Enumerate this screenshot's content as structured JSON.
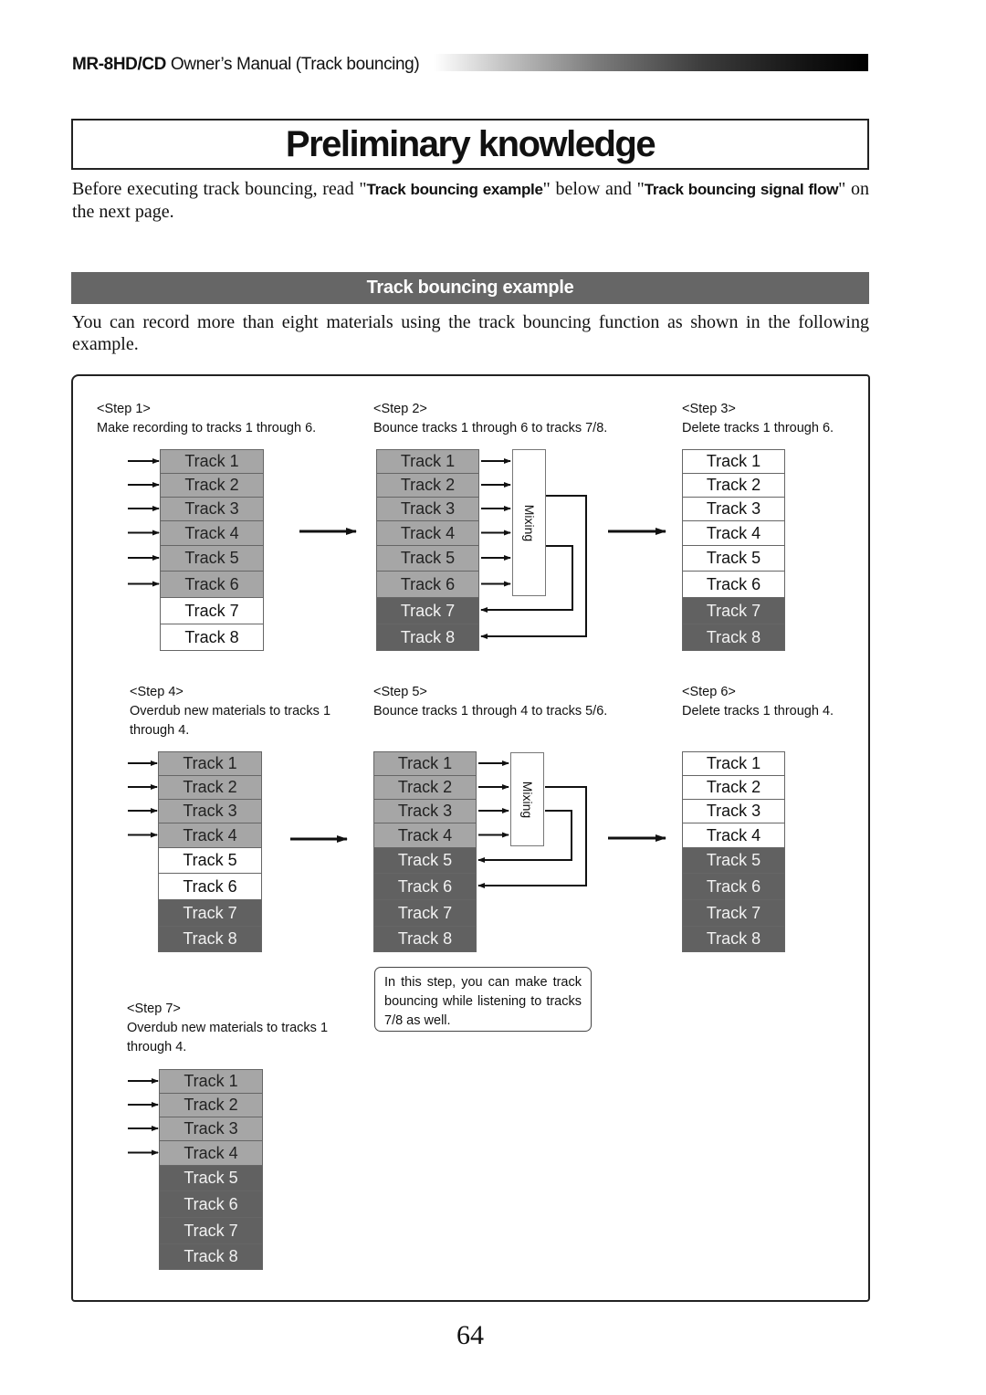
{
  "header": {
    "model": "MR-8HD/CD",
    "title_suffix": " Owner’s Manual (Track bouncing)"
  },
  "page_title": "Preliminary knowledge",
  "intro": {
    "t1": "Before executing track bouncing, read \"",
    "b1": "Track bouncing example",
    "t2": "\" below and \"",
    "b2": "Track bouncing signal flow",
    "t3": "\" on the next page."
  },
  "section": {
    "heading": "Track bouncing example",
    "body": "You can record more than eight materials using the track bouncing function as shown in the following example."
  },
  "steps": [
    {
      "label": "<Step 1>",
      "desc": "Make recording to tracks 1 through 6.",
      "tracks": [
        "Track 1",
        "Track 2",
        "Track 3",
        "Track 4",
        "Track 5",
        "Track 6",
        "Track 7",
        "Track 8"
      ],
      "states": [
        "light",
        "light",
        "light",
        "light",
        "light",
        "light",
        "white",
        "white"
      ],
      "inputs": [
        1,
        2,
        3,
        4,
        5,
        6
      ]
    },
    {
      "label": "<Step 2>",
      "desc": "Bounce tracks 1 through 6 to tracks 7/8.",
      "tracks": [
        "Track 1",
        "Track 2",
        "Track 3",
        "Track 4",
        "Track 5",
        "Track 6",
        "Track 7",
        "Track 8"
      ],
      "states": [
        "light",
        "light",
        "light",
        "light",
        "light",
        "light",
        "dark",
        "dark"
      ],
      "mixing_label": "Mixing",
      "mix_sources": [
        1,
        2,
        3,
        4,
        5,
        6
      ],
      "mix_targets": [
        7,
        8
      ]
    },
    {
      "label": "<Step 3>",
      "desc": "Delete tracks 1 through 6.",
      "tracks": [
        "Track 1",
        "Track 2",
        "Track 3",
        "Track 4",
        "Track 5",
        "Track 6",
        "Track 7",
        "Track 8"
      ],
      "states": [
        "white",
        "white",
        "white",
        "white",
        "white",
        "white",
        "dark",
        "dark"
      ]
    },
    {
      "label": "<Step 4>",
      "desc_line1": "Overdub new materials to tracks 1",
      "desc_line2": "through 4.",
      "tracks": [
        "Track 1",
        "Track 2",
        "Track 3",
        "Track 4",
        "Track 5",
        "Track 6",
        "Track 7",
        "Track 8"
      ],
      "states": [
        "light",
        "light",
        "light",
        "light",
        "white",
        "white",
        "dark",
        "dark"
      ],
      "inputs": [
        1,
        2,
        3,
        4
      ]
    },
    {
      "label": "<Step 5>",
      "desc": "Bounce tracks 1 through 4 to tracks 5/6.",
      "tracks": [
        "Track 1",
        "Track 2",
        "Track 3",
        "Track 4",
        "Track 5",
        "Track 6",
        "Track 7",
        "Track 8"
      ],
      "states": [
        "light",
        "light",
        "light",
        "light",
        "dark",
        "dark",
        "dark",
        "dark"
      ],
      "mixing_label": "Mixing",
      "mix_sources": [
        1,
        2,
        3,
        4
      ],
      "mix_targets": [
        5,
        6
      ]
    },
    {
      "label": "<Step 6>",
      "desc": "Delete tracks 1 through 4.",
      "tracks": [
        "Track 1",
        "Track 2",
        "Track 3",
        "Track 4",
        "Track 5",
        "Track 6",
        "Track 7",
        "Track 8"
      ],
      "states": [
        "white",
        "white",
        "white",
        "white",
        "dark",
        "dark",
        "dark",
        "dark"
      ]
    },
    {
      "label": "<Step 7>",
      "desc_line1": "Overdub new materials to tracks 1",
      "desc_line2": "through 4.",
      "tracks": [
        "Track 1",
        "Track 2",
        "Track 3",
        "Track 4",
        "Track 5",
        "Track 6",
        "Track 7",
        "Track 8"
      ],
      "states": [
        "light",
        "light",
        "light",
        "light",
        "dark",
        "dark",
        "dark",
        "dark"
      ],
      "inputs": [
        1,
        2,
        3,
        4
      ]
    }
  ],
  "note": "In this step, you can make track bouncing while listening to tracks 7/8 as well.",
  "page_number": "64",
  "colors": {
    "light": "#a6a6a6",
    "dark": "#616161",
    "white": "#ffffff",
    "band": "#666666"
  }
}
